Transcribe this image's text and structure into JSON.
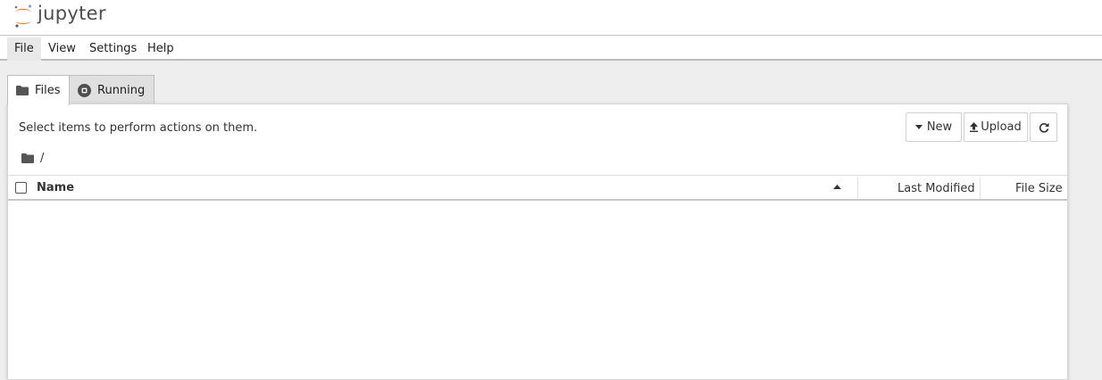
{
  "app": {
    "logo_text": "jupyter",
    "logo_color": "#f37726"
  },
  "menu": {
    "items": [
      "File",
      "View",
      "Settings",
      "Help"
    ],
    "active": "File"
  },
  "tabs": [
    {
      "label": "Files",
      "icon": "folder-icon",
      "active": true
    },
    {
      "label": "Running",
      "icon": "stop-circle-icon",
      "active": false
    }
  ],
  "toolbar": {
    "select_text": "Select items to perform actions on them.",
    "new_label": "New",
    "upload_label": "Upload",
    "refresh_icon": "refresh-icon"
  },
  "breadcrumb": {
    "path": "/"
  },
  "file_list": {
    "columns": {
      "name": "Name",
      "last_modified": "Last Modified",
      "file_size": "File Size"
    },
    "rows": []
  }
}
